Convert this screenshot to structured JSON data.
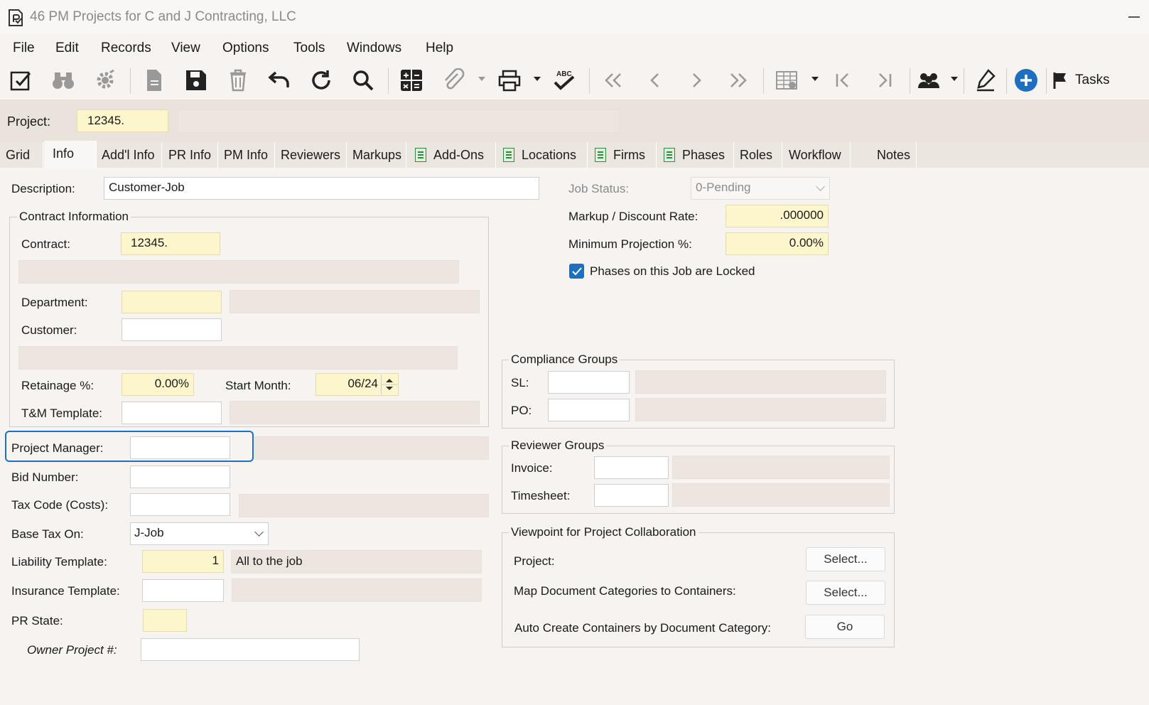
{
  "window": {
    "title": "46 PM Projects for C and J Contracting, LLC"
  },
  "menu": [
    "File",
    "Edit",
    "Records",
    "View",
    "Options",
    "Tools",
    "Windows",
    "Help"
  ],
  "toolbar": {
    "tasks_label": "Tasks"
  },
  "project": {
    "label": "Project:",
    "value": "12345.",
    "desc": ""
  },
  "tabs": [
    "Grid",
    "Info",
    "Add'l Info",
    "PR Info",
    "PM Info",
    "Reviewers",
    "Markups",
    "Add-Ons",
    "Locations",
    "Firms",
    "Phases",
    "Roles",
    "Workflow",
    "Notes"
  ],
  "form": {
    "description": {
      "label": "Description:",
      "value": "Customer-Job"
    },
    "job_status": {
      "label": "Job Status:",
      "value": "0-Pending"
    },
    "markup_rate": {
      "label": "Markup / Discount Rate:",
      "value": ".000000"
    },
    "min_projection": {
      "label": "Minimum Projection %:",
      "value": "0.00%"
    },
    "phases_locked": {
      "label": "Phases on this Job are Locked",
      "checked": true
    },
    "contract_group": {
      "title": "Contract Information",
      "contract": {
        "label": "Contract:",
        "value": "12345."
      },
      "department": {
        "label": "Department:",
        "value": ""
      },
      "customer": {
        "label": "Customer:",
        "value": ""
      },
      "retainage": {
        "label": "Retainage %:",
        "value": "0.00%"
      },
      "start_month": {
        "label": "Start Month:",
        "value": "06/24"
      },
      "tm_template": {
        "label": "T&M Template:",
        "value": ""
      }
    },
    "project_manager": {
      "label": "Project Manager:",
      "value": ""
    },
    "bid_number": {
      "label": "Bid Number:",
      "value": ""
    },
    "tax_code": {
      "label": "Tax Code (Costs):",
      "value": ""
    },
    "base_tax_on": {
      "label": "Base Tax On:",
      "value": "J-Job"
    },
    "liability_template": {
      "label": "Liability Template:",
      "value": "1",
      "desc": "All to the job"
    },
    "insurance_template": {
      "label": "Insurance Template:",
      "value": ""
    },
    "pr_state": {
      "label": "PR State:",
      "value": ""
    },
    "owner_project": {
      "label": "Owner Project #:",
      "value": ""
    },
    "compliance": {
      "title": "Compliance Groups",
      "sl": {
        "label": "SL:",
        "value": ""
      },
      "po": {
        "label": "PO:",
        "value": ""
      }
    },
    "reviewer": {
      "title": "Reviewer Groups",
      "invoice": {
        "label": "Invoice:",
        "value": ""
      },
      "timesheet": {
        "label": "Timesheet:",
        "value": ""
      }
    },
    "viewpoint": {
      "title": "Viewpoint for Project Collaboration",
      "project": {
        "label": "Project:",
        "button": "Select..."
      },
      "map_docs": {
        "label": "Map Document Categories to Containers:",
        "button": "Select..."
      },
      "auto_create": {
        "label": "Auto Create Containers by Document Category:",
        "button": "Go"
      }
    }
  },
  "colors": {
    "accent": "#1e6fc0",
    "required": "#fdf6cc",
    "readonly": "#ede6df",
    "checkbox": "#1e6fc0"
  },
  "icons": [
    "edit-icon",
    "binoculars-icon",
    "gear-icon",
    "new-document-icon",
    "save-icon",
    "trash-icon",
    "undo-icon",
    "refresh-icon",
    "search-icon",
    "calculator-icon",
    "attachment-icon",
    "print-icon",
    "spellcheck-icon",
    "first-record-icon",
    "previous-record-icon",
    "next-record-icon",
    "last-record-icon",
    "grid-view-icon",
    "first-icon",
    "last-icon",
    "users-icon",
    "pen-icon",
    "add-icon",
    "flag-icon"
  ]
}
